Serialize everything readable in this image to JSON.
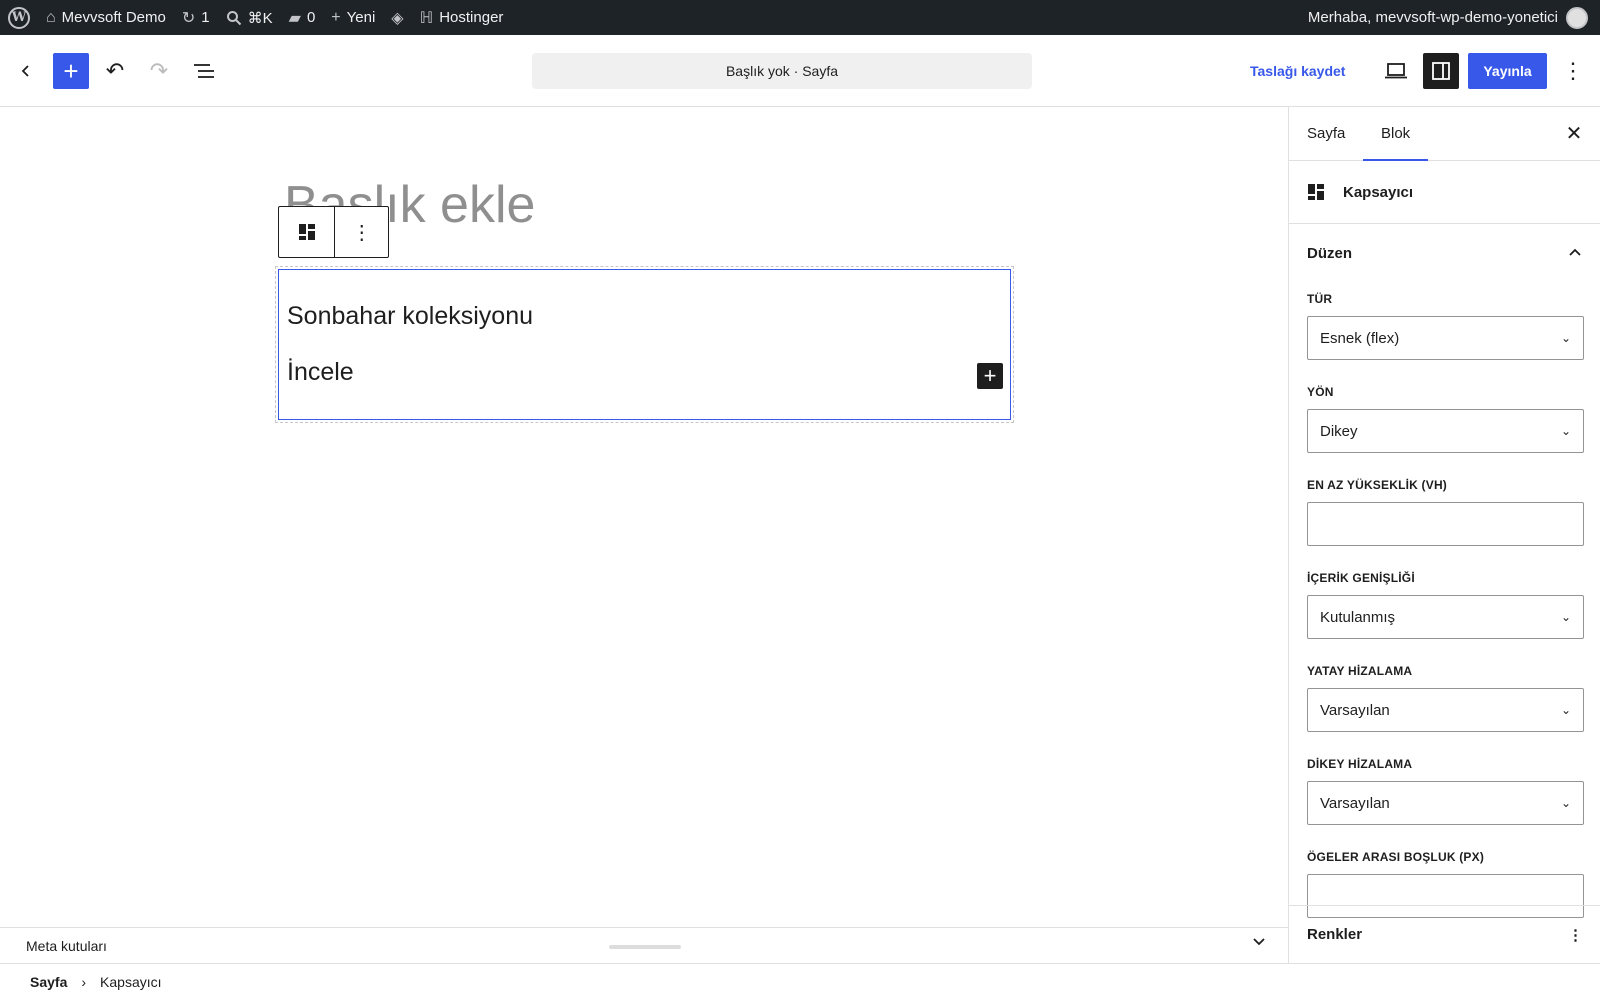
{
  "adminbar": {
    "site_name": "Mevvsoft Demo",
    "updates_count": "1",
    "search_shortcut": "⌘K",
    "comments_count": "0",
    "new_label": "Yeni",
    "hostinger_label": "Hostinger",
    "greeting": "Merhaba, mevvsoft-wp-demo-yonetici"
  },
  "header": {
    "document_title": "Başlık yok · Sayfa",
    "save_draft": "Taslağı kaydet",
    "publish": "Yayınla"
  },
  "canvas": {
    "title_placeholder": "Başlık ekle",
    "group_heading": "Sonbahar koleksiyonu",
    "group_text": "İncele"
  },
  "sidebar": {
    "tabs": [
      "Sayfa",
      "Blok"
    ],
    "active_tab": "Blok",
    "block_name": "Kapsayıcı",
    "panel_title": "Düzen",
    "fields": [
      {
        "label": "TÜR",
        "value": "Esnek (flex)",
        "type": "select"
      },
      {
        "label": "YÖN",
        "value": "Dikey",
        "type": "select"
      },
      {
        "label": "EN AZ YÜKSEKLİK (VH)",
        "value": "",
        "type": "input"
      },
      {
        "label": "İÇERİK GENİŞLİĞİ",
        "value": "Kutulanmış",
        "type": "select"
      },
      {
        "label": "YATAY HİZALAMA",
        "value": "Varsayılan",
        "type": "select"
      },
      {
        "label": "DİKEY HİZALAMA",
        "value": "Varsayılan",
        "type": "select"
      },
      {
        "label": "ÖGELER ARASI BOŞLUK (PX)",
        "value": "",
        "type": "input"
      }
    ],
    "colors_panel": "Renkler"
  },
  "meta": {
    "label": "Meta kutuları"
  },
  "breadcrumb": {
    "root": "Sayfa",
    "current": "Kapsayıcı"
  },
  "colors": {
    "accent": "#3858e9",
    "adminbar_bg": "#1d2327",
    "text": "#1e1e1e"
  }
}
